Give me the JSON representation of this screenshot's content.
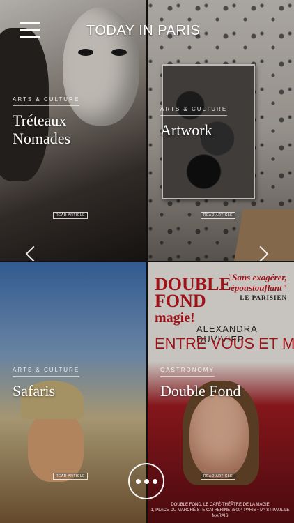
{
  "header": {
    "title": "TODAY IN PARIS",
    "menu_icon": "hamburger-menu-icon"
  },
  "tiles": [
    {
      "category": "ARTS & CULTURE",
      "title_line1": "Tréteaux",
      "title_line2": "Nomades",
      "read_label": "READ ARTICLE"
    },
    {
      "category": "ARTS & CULTURE",
      "title_line1": "Artwork",
      "read_label": "READ ARTICLE"
    },
    {
      "category": "ARTS & CULTURE",
      "title_line1": "Safaris",
      "read_label": "READ ARTICLE"
    },
    {
      "category": "GASTRONOMY",
      "title_line1": "Double Fond",
      "read_label": "READ ARTICLE"
    }
  ],
  "poster": {
    "brand_line1": "DOUBLE",
    "brand_line2": "FOND",
    "brand_line3": "magie!",
    "quote": "\"Sans exagérer, époustouflant\"",
    "quote_source": "LE PARISIEN",
    "performer": "ALEXANDRA DUVIVIER",
    "show": "ENTRE VOUS ET MOI",
    "footer_line1": "DOUBLE FOND, LE CAFÉ-THÉÂTRE DE LA MAGIE",
    "footer_line2": "1, PLACE DU MARCHÉ STE CATHERINE 75004 PARIS • M° ST PAUL LE MARAIS"
  },
  "nav": {
    "prev_icon": "chevron-left-icon",
    "next_icon": "chevron-right-icon",
    "more_icon": "more-dots-icon"
  },
  "colors": {
    "accent_red": "#c4171f",
    "text_white": "#ffffff"
  }
}
